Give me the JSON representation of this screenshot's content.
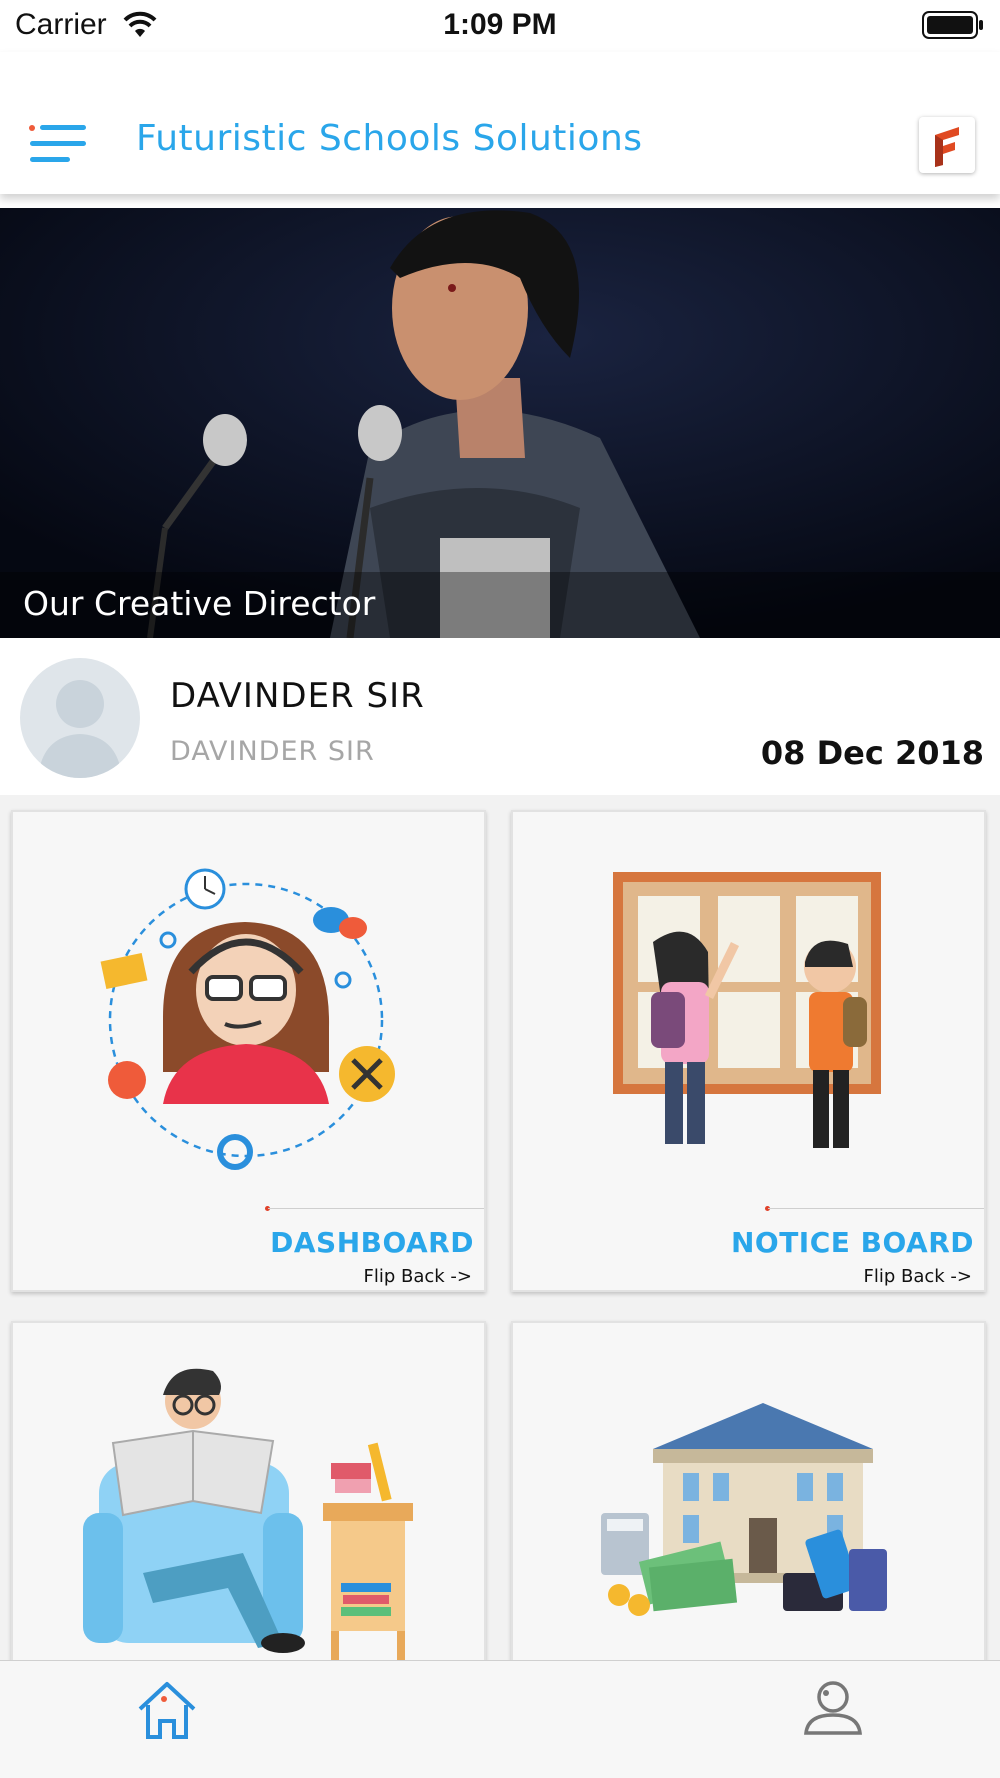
{
  "status_bar": {
    "carrier": "Carrier",
    "time": "1:09 PM"
  },
  "nav": {
    "title": "Futuristic Schools Solutions",
    "accent_color": "#2aa6ea"
  },
  "banner": {
    "caption": "Our Creative Director"
  },
  "profile": {
    "name": "DAVINDER SIR",
    "subtitle": "DAVINDER SIR",
    "date": "08 Dec 2018"
  },
  "cards": [
    {
      "title": "DASHBOARD",
      "flip": "Flip Back ->",
      "icon": "support-agent-illustration"
    },
    {
      "title": "NOTICE BOARD",
      "flip": "Flip Back ->",
      "icon": "notice-board-illustration"
    },
    {
      "title": "",
      "flip": "",
      "icon": "reading-newspaper-illustration"
    },
    {
      "title": "",
      "flip": "",
      "icon": "bank-fees-illustration"
    }
  ],
  "tab_bar": {
    "items": [
      {
        "icon": "home-icon",
        "active": true
      },
      {
        "icon": "profile-icon",
        "active": false
      }
    ]
  }
}
